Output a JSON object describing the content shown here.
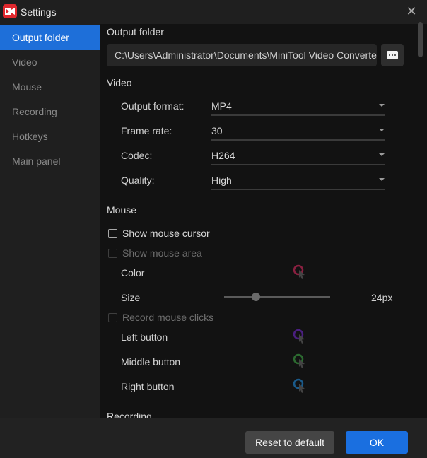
{
  "window": {
    "title": "Settings",
    "app_icon": "video-camera-icon",
    "close_icon": "close-icon"
  },
  "sidebar": {
    "items": [
      {
        "label": "Output folder",
        "active": true
      },
      {
        "label": "Video",
        "active": false
      },
      {
        "label": "Mouse",
        "active": false
      },
      {
        "label": "Recording",
        "active": false
      },
      {
        "label": "Hotkeys",
        "active": false
      },
      {
        "label": "Main panel",
        "active": false
      }
    ]
  },
  "output_folder": {
    "title": "Output folder",
    "path": "C:\\Users\\Administrator\\Documents\\MiniTool Video Converter",
    "browse_icon": "more-dots-icon"
  },
  "video": {
    "title": "Video",
    "fields": [
      {
        "label": "Output format:",
        "value": "MP4"
      },
      {
        "label": "Frame rate:",
        "value": "30"
      },
      {
        "label": "Codec:",
        "value": "H264"
      },
      {
        "label": "Quality:",
        "value": "High"
      }
    ]
  },
  "mouse": {
    "title": "Mouse",
    "show_cursor": {
      "label": "Show mouse cursor",
      "checked": false,
      "enabled": true
    },
    "show_area": {
      "label": "Show mouse area",
      "checked": false,
      "enabled": false
    },
    "color": {
      "label": "Color",
      "swatch": "#8a2040"
    },
    "size": {
      "label": "Size",
      "value_text": "24px",
      "fraction": 0.3
    },
    "record_clicks": {
      "label": "Record mouse clicks",
      "checked": false,
      "enabled": false
    },
    "buttons": [
      {
        "label": "Left button",
        "color": "#4a1f80"
      },
      {
        "label": "Middle button",
        "color": "#2c6a30"
      },
      {
        "label": "Right button",
        "color": "#1a5a8a"
      }
    ]
  },
  "recording": {
    "title": "Recording"
  },
  "footer": {
    "reset_label": "Reset to default",
    "ok_label": "OK"
  },
  "colors": {
    "accent": "#1e6fd9",
    "app_icon": "#e0282e"
  }
}
